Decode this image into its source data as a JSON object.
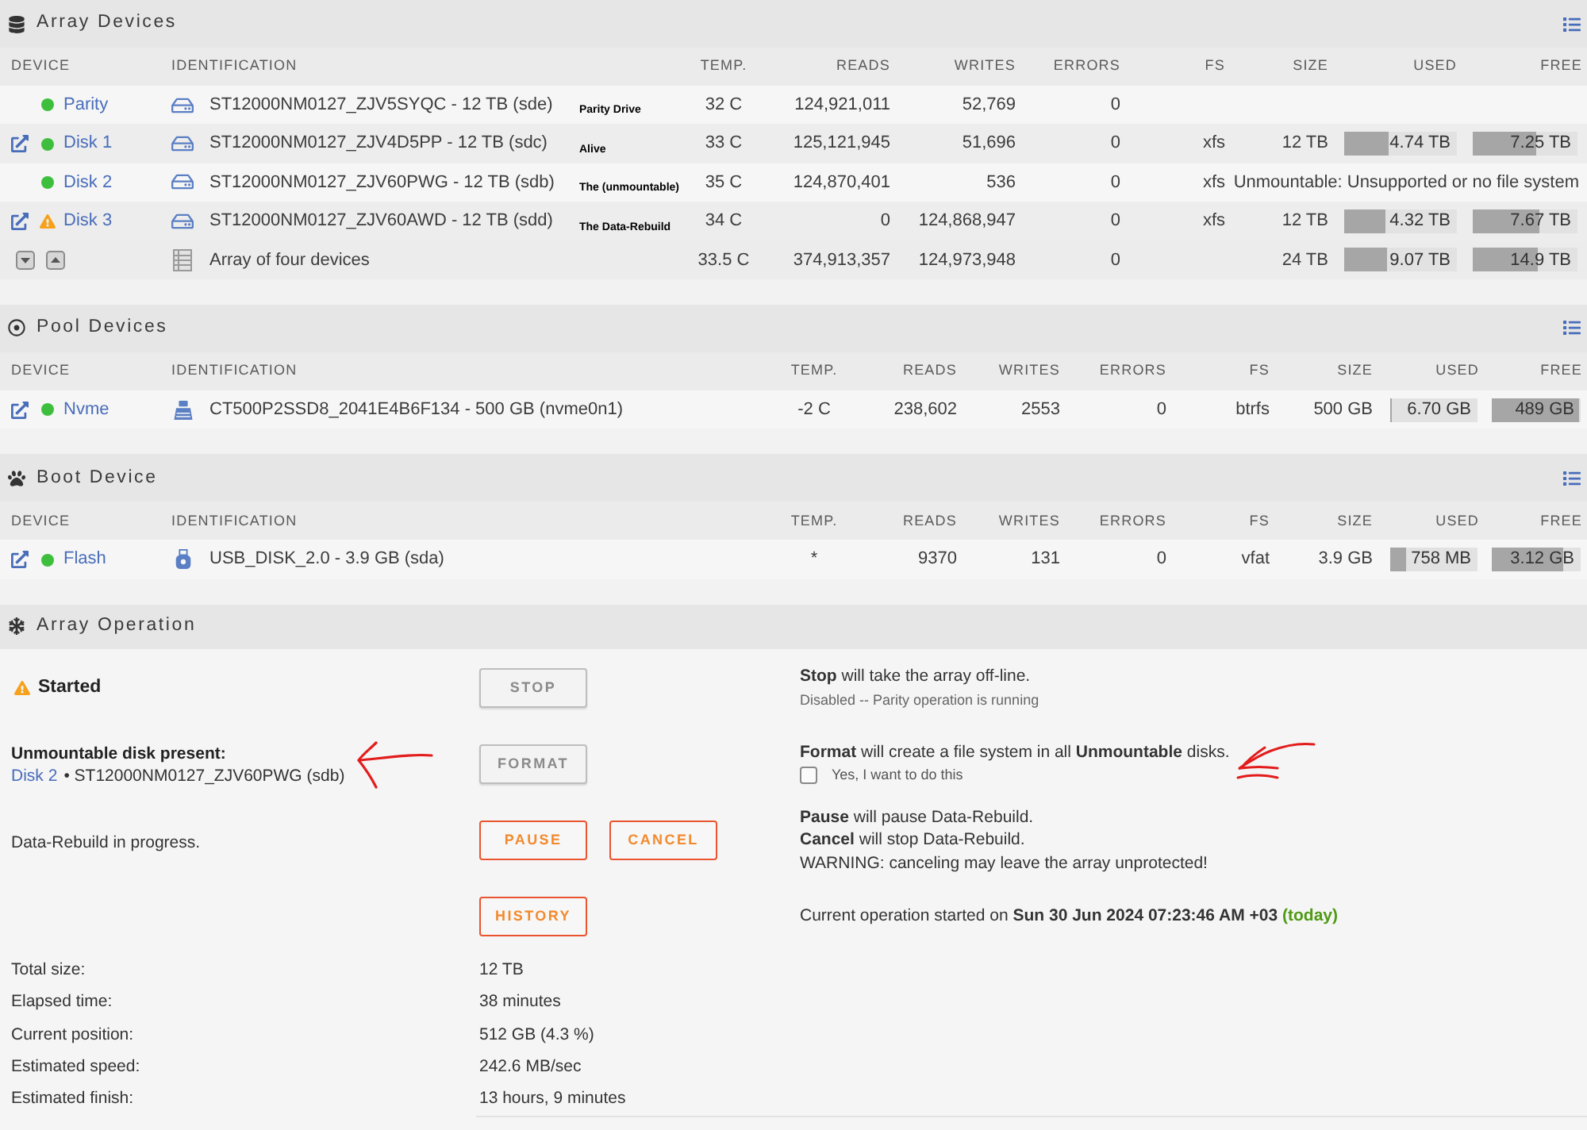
{
  "array_devices": {
    "title": "Array Devices",
    "columns": [
      "DEVICE",
      "IDENTIFICATION",
      "TEMP.",
      "READS",
      "WRITES",
      "ERRORS",
      "FS",
      "SIZE",
      "USED",
      "FREE"
    ],
    "rows": [
      {
        "kind": "hdd",
        "device": "Parity",
        "warning": false,
        "external_link": false,
        "identification": "ST12000NM0127_ZJV5SYQC - 12 TB (sde)",
        "annotation": "Parity Drive",
        "temp": "32 C",
        "reads": "124,921,011",
        "writes": "52,769",
        "errors": "0"
      },
      {
        "kind": "hdd",
        "device": "Disk 1",
        "warning": false,
        "external_link": true,
        "identification": "ST12000NM0127_ZJV4D5PP - 12 TB (sdc)",
        "annotation": "Alive",
        "temp": "33 C",
        "reads": "125,121,945",
        "writes": "51,696",
        "errors": "0",
        "fs": "xfs",
        "size": "12 TB",
        "used": {
          "reading": "4.74 TB",
          "level": 0.395
        },
        "free": {
          "reading": "7.25 TB",
          "level": 0.604
        }
      },
      {
        "kind": "hdd",
        "device": "Disk 2",
        "warning": false,
        "external_link": false,
        "identification": "ST12000NM0127_ZJV60PWG - 12 TB (sdb)",
        "annotation": "The (unmountable)",
        "temp": "35 C",
        "reads": "124,870,401",
        "writes": "536",
        "errors": "0",
        "fs": "xfs",
        "note": "Unmountable: Unsupported or no file system"
      },
      {
        "kind": "hdd",
        "device": "Disk 3",
        "warning": true,
        "external_link": true,
        "identification": "ST12000NM0127_ZJV60AWD - 12 TB (sdd)",
        "annotation": "The Data-Rebuild",
        "temp": "34 C",
        "reads": "0",
        "writes": "124,868,947",
        "errors": "0",
        "fs": "xfs",
        "size": "12 TB",
        "used": {
          "reading": "4.32 TB",
          "level": 0.36
        },
        "free": {
          "reading": "7.67 TB",
          "level": 0.64
        }
      },
      {
        "kind": "summary",
        "identification": "Array of four devices",
        "temp": "33.5 C",
        "reads": "374,913,357",
        "writes": "124,973,948",
        "errors": "0",
        "size": "24 TB",
        "used": {
          "reading": "9.07 TB",
          "level": 0.378
        },
        "free": {
          "reading": "14.9 TB",
          "level": 0.62
        }
      }
    ]
  },
  "pool_devices": {
    "title": "Pool Devices",
    "columns": [
      "DEVICE",
      "IDENTIFICATION",
      "TEMP.",
      "READS",
      "WRITES",
      "ERRORS",
      "FS",
      "SIZE",
      "USED",
      "FREE"
    ],
    "rows": [
      {
        "kind": "nvme",
        "device": "Nvme",
        "warning": false,
        "external_link": true,
        "identification": "CT500P2SSD8_2041E4B6F134 - 500 GB (nvme0n1)",
        "temp": "-2 C",
        "reads": "238,602",
        "writes": "2553",
        "errors": "0",
        "fs": "btrfs",
        "size": "500 GB",
        "used": {
          "reading": "6.70 GB",
          "level": 0.013
        },
        "free": {
          "reading": "489 GB",
          "level": 0.978
        }
      }
    ]
  },
  "boot_device": {
    "title": "Boot Device",
    "columns": [
      "DEVICE",
      "IDENTIFICATION",
      "TEMP.",
      "READS",
      "WRITES",
      "ERRORS",
      "FS",
      "SIZE",
      "USED",
      "FREE"
    ],
    "rows": [
      {
        "kind": "usb",
        "device": "Flash",
        "warning": false,
        "external_link": true,
        "identification": "USB_DISK_2.0 - 3.9 GB (sda)",
        "temp": "*",
        "reads": "9370",
        "writes": "131",
        "errors": "0",
        "fs": "vfat",
        "size": "3.9 GB",
        "used": {
          "reading": "758 MB",
          "level": 0.19
        },
        "free": {
          "reading": "3.12 GB",
          "level": 0.8
        }
      }
    ]
  },
  "array_operation": {
    "title": "Array Operation",
    "rows": [
      {
        "left": {
          "kind": "status",
          "warning": true,
          "text": "Started"
        },
        "buttons": [
          {
            "label": "STOP",
            "disabled": true
          }
        ],
        "help": [
          {
            "kind": "text",
            "text": "**Stop** will take the array off-line.",
            "arrow": false
          },
          {
            "kind": "note",
            "text": "Disabled -- Parity operation is running"
          }
        ]
      },
      {
        "left": {
          "kind": "disk",
          "heading": "Unmountable disk present:",
          "link": "Disk 2",
          "detail": "• ST12000NM0127_ZJV60PWG (sdb)",
          "arrow": true
        },
        "buttons": [
          {
            "label": "FORMAT",
            "disabled": true
          }
        ],
        "help": [
          {
            "kind": "text",
            "text": "**Format** will create a file system in all **Unmountable** disks.",
            "arrow": true
          },
          {
            "kind": "checkbox",
            "label": "Yes, I want to do this",
            "checked": false
          }
        ]
      },
      {
        "left": {
          "kind": "text",
          "text": "Data-Rebuild in progress."
        },
        "buttons": [
          {
            "label": "PAUSE",
            "disabled": false
          },
          {
            "label": "CANCEL",
            "disabled": false
          }
        ],
        "help": [
          {
            "kind": "text",
            "text": "**Pause** will pause Data-Rebuild.",
            "arrow": false
          },
          {
            "kind": "text",
            "text": "**Cancel** will stop Data-Rebuild.",
            "arrow": false
          },
          {
            "kind": "text",
            "text": "WARNING: canceling may leave the array unprotected!",
            "arrow": false
          }
        ]
      },
      {
        "buttons": [
          {
            "label": "HISTORY",
            "disabled": false
          }
        ],
        "help": [
          {
            "kind": "timestamp",
            "text": "Current operation started on **Sun 30 Jun 2024 07:23:46 AM +03**",
            "relative": "(today)"
          }
        ]
      }
    ],
    "stats": [
      {
        "label": "Total size:",
        "value": "12 TB"
      },
      {
        "label": "Elapsed time:",
        "value": "38 minutes"
      },
      {
        "label": "Current position:",
        "value": "512 GB (4.3 %)"
      },
      {
        "label": "Estimated speed:",
        "value": "242.6 MB/sec"
      },
      {
        "label": "Estimated finish:",
        "value": "13 hours, 9 minutes"
      }
    ]
  }
}
